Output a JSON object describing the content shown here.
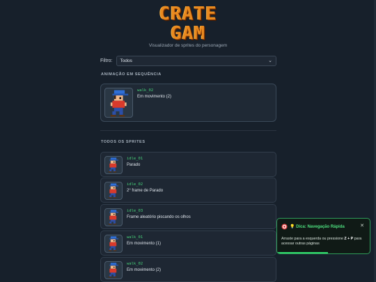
{
  "header": {
    "logo_line1": "CRATE",
    "logo_line2": "GAM",
    "subtitle": "Visualizador de sprites do personagem"
  },
  "filter": {
    "label": "Filtro:",
    "selected": "Todos"
  },
  "animation": {
    "section_title": "ANIMAÇÃO EM SEQUÊNCIA",
    "sprite_code": "walk_02",
    "sprite_desc": "Em movimento (2)"
  },
  "all_sprites": {
    "section_title": "TODOS OS SPRITES",
    "items": [
      {
        "code": "idle_01",
        "desc": "Parado"
      },
      {
        "code": "idle_02",
        "desc": "2° frame de Parado"
      },
      {
        "code": "idle_03",
        "desc": "Frame aleatório piscando os olhos"
      },
      {
        "code": "walk_01",
        "desc": "Em movimento (1)"
      },
      {
        "code": "walk_02",
        "desc": "Em movimento (2)"
      }
    ]
  },
  "toast": {
    "icon": "target-icon",
    "title": "💡 Dica: Navegação Rápida",
    "body_pre": "Arraste para a esquerda ou pressione ",
    "body_keys": "Z + P",
    "body_post": " para acessar outras páginas",
    "close": "✕",
    "progress": 0.55
  },
  "colors": {
    "background": "#17202b",
    "accent_green": "#4ee07f",
    "logo_orange": "#e98a1f"
  }
}
